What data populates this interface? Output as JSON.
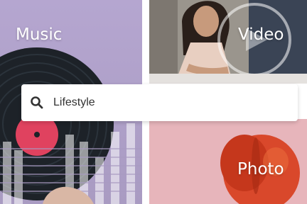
{
  "tiles": {
    "music": {
      "label": "Music"
    },
    "video": {
      "label": "Video"
    },
    "photo": {
      "label": "Photo"
    }
  },
  "search": {
    "value": "Lifestyle",
    "icon": "search-icon"
  },
  "colors": {
    "music_bg": "#b1a2c9",
    "video_bg": "#8f8a83",
    "photo_bg": "#e7b5bb",
    "record_label": "#e0425f",
    "peach": "#d9482b",
    "search_text": "#333333"
  }
}
